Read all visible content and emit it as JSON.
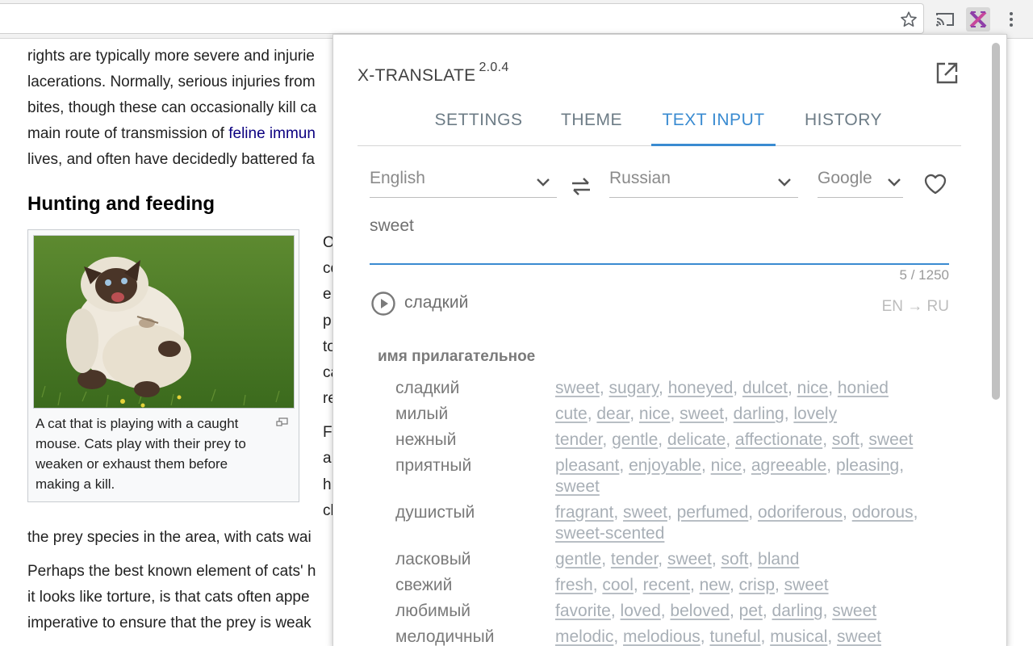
{
  "browser": {
    "icons": [
      "star-icon",
      "cast-icon",
      "x-translate-extension-icon",
      "more-menu-icon"
    ]
  },
  "article": {
    "lines_top": [
      {
        "text": "rights are typically more severe and injurie",
        "link": ""
      },
      {
        "text": "lacerations. Normally, serious injuries from",
        "link": ""
      },
      {
        "text": "bites, though these can occasionally kill ca",
        "link": ""
      },
      {
        "pre": "main route of transmission of ",
        "link": "feline immun"
      },
      {
        "text": "lives, and often have decidedly battered fa",
        "link": ""
      }
    ],
    "heading": "Hunting and feeding",
    "caption": "A cat that is playing with a caught mouse. Cats play with their prey to weaken or exhaust them before making a kill.",
    "right_fragments": [
      "O",
      "co",
      "e",
      "p",
      "to",
      "ca",
      "re",
      "F",
      "a",
      "h",
      "cl"
    ],
    "lines_bottom": [
      "the prey species in the area, with cats wai",
      "Perhaps the best known element of cats' h",
      "it looks like torture, is that cats often appe",
      "imperative to ensure that the prey is weak"
    ]
  },
  "popup": {
    "app_name": "X-TRANSLATE",
    "version": "2.0.4",
    "tabs": [
      "SETTINGS",
      "THEME",
      "TEXT INPUT",
      "HISTORY"
    ],
    "active_tab": "TEXT INPUT",
    "from_lang": "English",
    "to_lang": "Russian",
    "engine": "Google",
    "input_text": "sweet",
    "char_counter": "5 / 1250",
    "translation": "сладкий",
    "lang_pair": "EN → RU",
    "part_of_speech": "имя прилагательное",
    "dictionary": [
      {
        "word": "сладкий",
        "synonyms": [
          "sweet",
          "sugary",
          "honeyed",
          "dulcet",
          "nice",
          "honied"
        ]
      },
      {
        "word": "милый",
        "synonyms": [
          "cute",
          "dear",
          "nice",
          "sweet",
          "darling",
          "lovely"
        ]
      },
      {
        "word": "нежный",
        "synonyms": [
          "tender",
          "gentle",
          "delicate",
          "affectionate",
          "soft",
          "sweet"
        ]
      },
      {
        "word": "приятный",
        "synonyms": [
          "pleasant",
          "enjoyable",
          "nice",
          "agreeable",
          "pleasing",
          "sweet"
        ]
      },
      {
        "word": "душистый",
        "synonyms": [
          "fragrant",
          "sweet",
          "perfumed",
          "odoriferous",
          "odorous",
          "sweet-scented"
        ]
      },
      {
        "word": "ласковый",
        "synonyms": [
          "gentle",
          "tender",
          "sweet",
          "soft",
          "bland"
        ]
      },
      {
        "word": "свежий",
        "synonyms": [
          "fresh",
          "cool",
          "recent",
          "new",
          "crisp",
          "sweet"
        ]
      },
      {
        "word": "любимый",
        "synonyms": [
          "favorite",
          "loved",
          "beloved",
          "pet",
          "darling",
          "sweet"
        ]
      },
      {
        "word": "мелодичный",
        "synonyms": [
          "melodic",
          "melodious",
          "tuneful",
          "musical",
          "sweet"
        ]
      }
    ],
    "colors": {
      "accent": "#3a8bd1",
      "synonym": "#a8afb6",
      "text": "#7a7a7a"
    }
  }
}
